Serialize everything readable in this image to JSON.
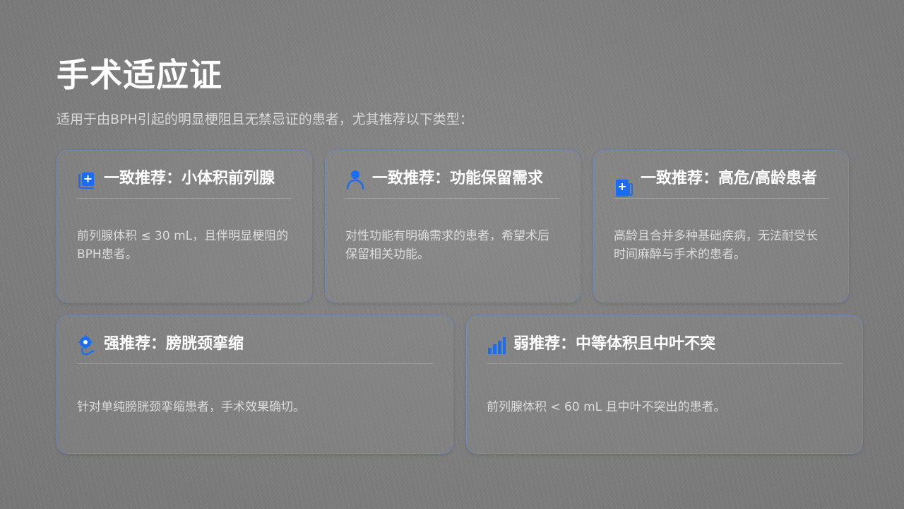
{
  "slide": {
    "title": "手术适应证",
    "subtitle": "适用于由BPH引起的明显梗阻且无禁忌证的患者，尤其推荐以下类型："
  },
  "cards": [
    {
      "title": "一致推荐：小体积前列腺",
      "text": "前列腺体积 ≤ 30 mL，且伴明显梗阻的BPH患者。",
      "icon": "medical-clipboard-icon"
    },
    {
      "title": "一致推荐：功能保留需求",
      "text": "对性功能有明确需求的患者，希望术后保留相关功能。",
      "icon": "user-icon"
    },
    {
      "title": "一致推荐：高危/高龄患者",
      "text": "高龄且合并多种基础疾病，无法耐受长时间麻醉与手术的患者。",
      "icon": "medical-kit-icon"
    },
    {
      "title": "强推荐：膀胱颈挛缩",
      "text": "针对单纯膀胱颈挛缩患者，手术效果确切。",
      "icon": "gear-pipe-icon"
    },
    {
      "title": "弱推荐：中等体积且中叶不突",
      "text": "前列腺体积 < 60 mL 且中叶不突出的患者。",
      "icon": "bar-chart-icon"
    }
  ],
  "colors": {
    "accent": "#1a6cf0",
    "card_border": "#6e8cc8",
    "text_primary": "#ffffff",
    "text_secondary": "#dcdcdc"
  }
}
